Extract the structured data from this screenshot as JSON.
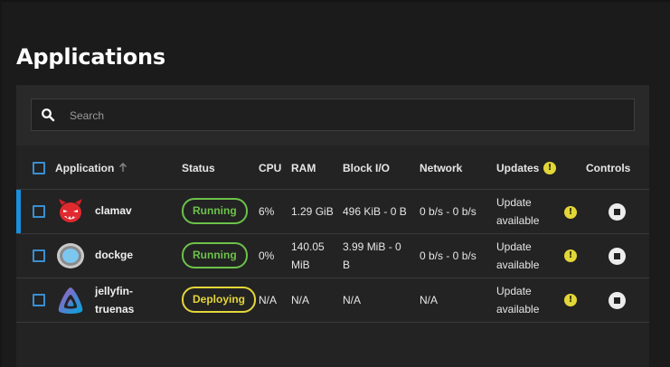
{
  "page": {
    "title": "Applications"
  },
  "search": {
    "placeholder": "Search",
    "value": ""
  },
  "table": {
    "columns": {
      "application": "Application",
      "status": "Status",
      "cpu": "CPU",
      "ram": "RAM",
      "block_io": "Block I/O",
      "network": "Network",
      "updates": "Updates",
      "controls": "Controls"
    },
    "sort_indicator": "arrow-up-icon",
    "rows": [
      {
        "name_line1": "clamav",
        "name_line2": "",
        "icon": "clamav-logo-icon",
        "status": "Running",
        "cpu": "6%",
        "ram_line1": "1.29 GiB",
        "ram_line2": "",
        "block_line1": "496 KiB - 0 B",
        "block_line2": "",
        "network": "0 b/s - 0 b/s",
        "update_line1": "Update",
        "update_line2": "available",
        "selected": true
      },
      {
        "name_line1": "dockge",
        "name_line2": "",
        "icon": "dockge-logo-icon",
        "status": "Running",
        "cpu": "0%",
        "ram_line1": "140.05",
        "ram_line2": "MiB",
        "block_line1": "3.99 MiB - 0",
        "block_line2": "B",
        "network": "0 b/s - 0 b/s",
        "update_line1": "Update",
        "update_line2": "available",
        "selected": false
      },
      {
        "name_line1": "jellyfin-",
        "name_line2": "truenas",
        "icon": "jellyfin-logo-icon",
        "status": "Deploying",
        "cpu": "N/A",
        "ram_line1": "N/A",
        "ram_line2": "",
        "block_line1": "N/A",
        "block_line2": "",
        "network": "N/A",
        "update_line1": "Update",
        "update_line2": "available",
        "selected": false
      }
    ]
  },
  "colors": {
    "accent": "#1a8fdd",
    "running": "#6cc24a",
    "deploying": "#e3d638",
    "warning": "#e3d638"
  }
}
